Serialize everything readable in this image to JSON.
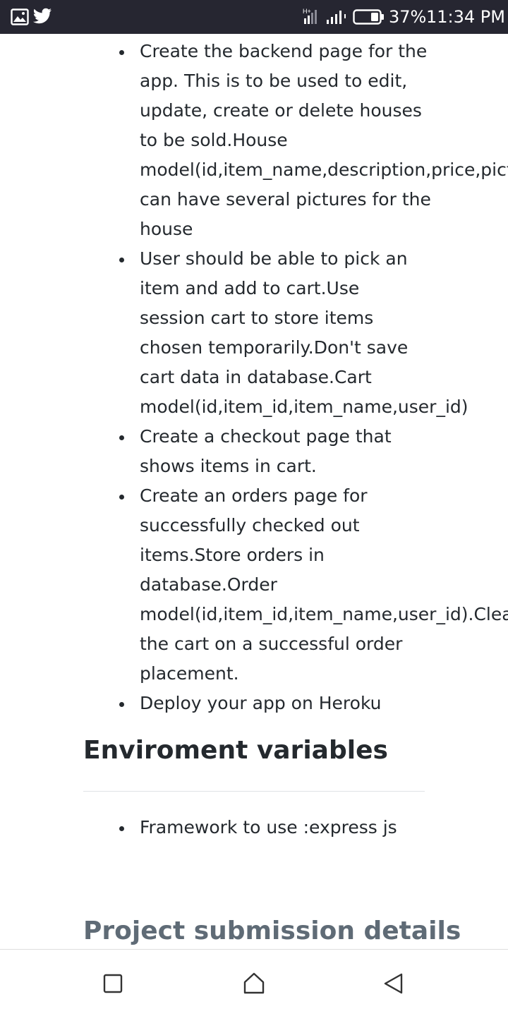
{
  "status_bar": {
    "left_icons": [
      "gallery-icon",
      "twitter-icon"
    ],
    "right_icons": [
      "signal-icon",
      "battery-icon"
    ],
    "battery_percent": "37%",
    "time": "11:34 PM"
  },
  "content": {
    "task_items": [
      [
        "Create the backend page for the",
        "app. This is to be used to edit,",
        "update, create or delete houses",
        "to be sold.House",
        "model(id,item_name,description,price,pictu",
        "can have several pictures for the",
        "house"
      ],
      [
        "User should be able to pick an",
        "item and add to cart.Use",
        "session cart to store items",
        "chosen temporarily.Don't save",
        "cart data in database.Cart",
        "model(id,item_id,item_name,user_id)"
      ],
      [
        "Create a checkout page that",
        "shows items in cart."
      ],
      [
        "Create an orders page for",
        "successfully checked out",
        "items.Store orders in",
        "database.Order",
        "model(id,item_id,item_name,user_id).Clear",
        "the cart on a successful order",
        "placement."
      ],
      [
        "Deploy your app on Heroku"
      ]
    ],
    "env_heading": "Enviroment variables",
    "env_items": [
      [
        "Framework to use :express js"
      ]
    ],
    "submission_heading": "Project submission details"
  },
  "nav_bar": {
    "buttons": [
      "recent-apps-icon",
      "home-icon",
      "back-icon"
    ]
  },
  "colors": {
    "status_bar_bg": "#262631",
    "text": "#24292e",
    "muted_heading": "#5f6b76",
    "divider": "#dfe2e5"
  }
}
